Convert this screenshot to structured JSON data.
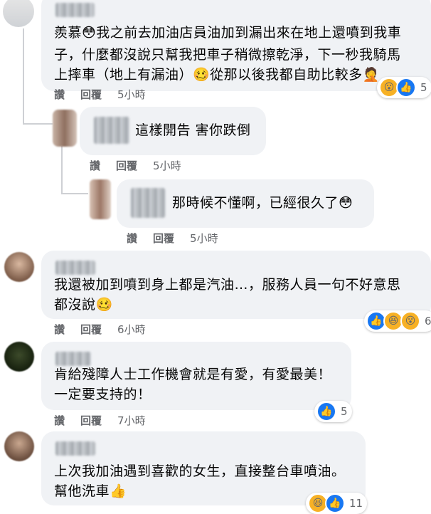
{
  "labels": {
    "read": "讚",
    "reply": "回覆"
  },
  "comments": [
    {
      "text_lines": [
        "羨慕😳我之前去加油店員油加到漏出來在地上還噴到我車",
        "子，什麼都沒說只幫我把車子稍微擦乾淨，下一秒我騎馬",
        "上摔車（地上有漏油）🥴從那以後我都自助比較多🤦"
      ],
      "time": "5小時",
      "reaction_count": "5"
    },
    {
      "text_lines": [
        "這樣開告 害你跌倒"
      ],
      "time": "5小時"
    },
    {
      "text_lines": [
        "那時候不懂啊，已經很久了😳"
      ],
      "time": "5小時"
    },
    {
      "text_lines": [
        "我還被加到噴到身上都是汽油…，服務人員一句不好意思",
        "都沒說🥴"
      ],
      "time": "6小時",
      "reaction_count": "6"
    },
    {
      "text_lines": [
        "肯給殘障人士工作機會就是有愛，有愛最美！",
        "一定要支持的！"
      ],
      "time": "7小時",
      "reaction_count": "5"
    },
    {
      "text_lines": [
        "上次我加油遇到喜歡的女生，直接整台車噴油。",
        "幫他洗車👍"
      ],
      "reaction_count": "11"
    }
  ],
  "colors": {
    "bubble": "#f0f2f5",
    "meta": "#65676b",
    "like": "#1877f2",
    "reaction_yellow": "#f7b125"
  }
}
